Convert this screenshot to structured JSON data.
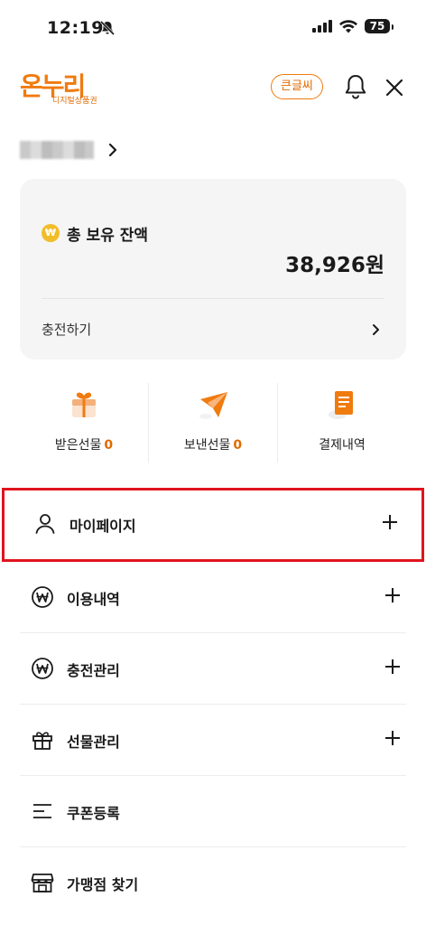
{
  "status": {
    "time": "12:19",
    "battery": "75"
  },
  "header": {
    "logo_main": "온누리",
    "logo_sub": "디지털상품권",
    "bigfont_label": "큰글씨"
  },
  "user": {
    "name_hidden": ""
  },
  "balance": {
    "label": "총 보유 잔액",
    "coin_symbol": "₩",
    "amount": "38,926원",
    "charge_label": "충전하기"
  },
  "quick_actions": [
    {
      "label": "받은선물",
      "count": "0",
      "icon": "received-gift-icon"
    },
    {
      "label": "보낸선물",
      "count": "0",
      "icon": "sent-gift-icon"
    },
    {
      "label": "결제내역",
      "count": "",
      "icon": "payment-history-icon"
    }
  ],
  "menu": [
    {
      "label": "마이페이지",
      "icon": "person-icon",
      "expandable": true
    },
    {
      "label": "이용내역",
      "icon": "won-coin-icon",
      "expandable": true
    },
    {
      "label": "충전관리",
      "icon": "won-coin-icon",
      "expandable": true
    },
    {
      "label": "선물관리",
      "icon": "gift-icon",
      "expandable": true
    },
    {
      "label": "쿠폰등록",
      "icon": "list-lines-icon",
      "expandable": false
    },
    {
      "label": "가맹점 찾기",
      "icon": "store-icon",
      "expandable": false
    }
  ],
  "colors": {
    "brand": "#f07b0f",
    "accent_count": "#e06a00",
    "highlight": "#e0141e",
    "card_bg": "#f5f5f6"
  }
}
